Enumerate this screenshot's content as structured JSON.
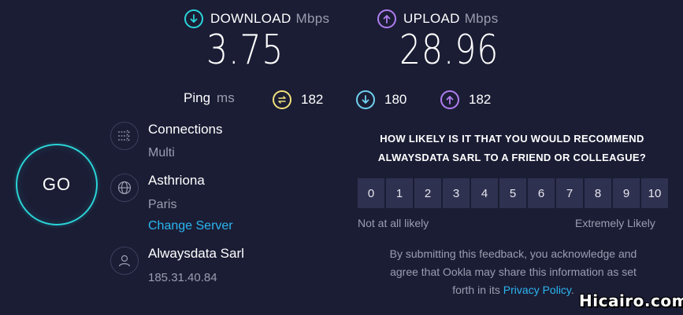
{
  "results": {
    "download": {
      "label": "DOWNLOAD",
      "unit": "Mbps",
      "value": "3.75",
      "icon": "download-arrow-icon",
      "color": "#2ad4d8"
    },
    "upload": {
      "label": "UPLOAD",
      "unit": "Mbps",
      "value": "28.96",
      "icon": "upload-arrow-icon",
      "color": "#b07ef0"
    }
  },
  "ping": {
    "label": "Ping",
    "unit": "ms",
    "idle": {
      "value": "182",
      "icon": "ping-idle-icon",
      "color": "#f2e07a"
    },
    "download": {
      "value": "180",
      "icon": "ping-download-icon",
      "color": "#6fd3f0"
    },
    "upload": {
      "value": "182",
      "icon": "ping-upload-icon",
      "color": "#b07ef0"
    }
  },
  "go_button": {
    "label": "GO"
  },
  "connections": {
    "title": "Connections",
    "value": "Multi",
    "icon": "connections-icon"
  },
  "server": {
    "name": "Asthriona",
    "location": "Paris",
    "change_label": "Change Server",
    "icon": "globe-icon"
  },
  "host": {
    "name": "Alwaysdata Sarl",
    "ip": "185.31.40.84",
    "icon": "user-icon"
  },
  "survey": {
    "question_line1": "HOW LIKELY IS IT THAT YOU WOULD RECOMMEND",
    "question_line2": "ALWAYSDATA SARL TO A FRIEND OR COLLEAGUE?",
    "scale": [
      "0",
      "1",
      "2",
      "3",
      "4",
      "5",
      "6",
      "7",
      "8",
      "9",
      "10"
    ],
    "low_label": "Not at all likely",
    "high_label": "Extremely Likely",
    "disclaimer_line1": "By submitting this feedback, you acknowledge and",
    "disclaimer_line2": "agree that Ookla may share this information as set",
    "disclaimer_line3_prefix": "forth in its ",
    "privacy_link": "Privacy Policy",
    "disclaimer_suffix": "."
  },
  "watermark": "Hicairo.com"
}
